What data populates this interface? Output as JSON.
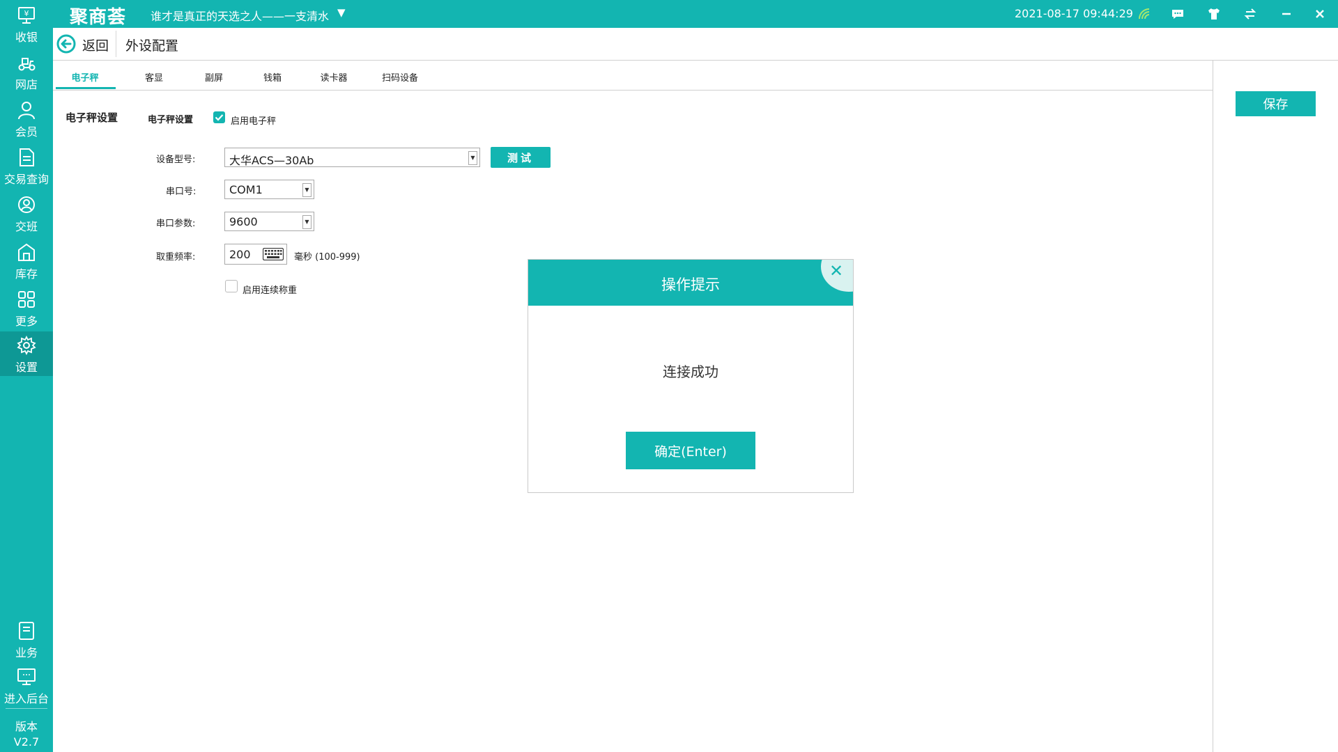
{
  "titlebar": {
    "logo": "聚商荟",
    "store_name": "谁才是真正的天选之人——一支清水",
    "datetime": "2021-08-17 09:44:29"
  },
  "sidebar": {
    "items": [
      {
        "label": "收银",
        "icon": "cashier-icon"
      },
      {
        "label": "网店",
        "icon": "scooter-icon"
      },
      {
        "label": "会员",
        "icon": "user-icon"
      },
      {
        "label": "交易查询",
        "icon": "document-icon"
      },
      {
        "label": "交班",
        "icon": "handover-icon"
      },
      {
        "label": "库存",
        "icon": "warehouse-icon"
      },
      {
        "label": "更多",
        "icon": "grid-icon"
      },
      {
        "label": "设置",
        "icon": "gear-icon"
      }
    ],
    "bottom_items": [
      {
        "label": "业务",
        "icon": "book-icon"
      },
      {
        "label": "进入后台",
        "icon": "monitor-icon"
      }
    ],
    "version_label": "版本",
    "version": "V2.7"
  },
  "header": {
    "back_label": "返回",
    "page_title": "外设配置"
  },
  "tabs": [
    {
      "label": "电子秤",
      "active": true
    },
    {
      "label": "客显",
      "active": false
    },
    {
      "label": "副屏",
      "active": false
    },
    {
      "label": "钱箱",
      "active": false
    },
    {
      "label": "读卡器",
      "active": false
    },
    {
      "label": "扫码设备",
      "active": false
    }
  ],
  "save_label": "保存",
  "form": {
    "section_title": "电子秤设置",
    "subsection_title": "电子秤设置",
    "enable_scale_label": "启用电子秤",
    "enable_scale_checked": true,
    "device_model_label": "设备型号:",
    "device_model_value": "大华ACS—30Ab",
    "test_label": "测试",
    "port_label": "串口号:",
    "port_value": "COM1",
    "params_label": "串口参数:",
    "params_value": "9600",
    "freq_label": "取重频率:",
    "freq_value": "200",
    "freq_unit": "毫秒 (100-999)",
    "continuous_label": "启用连续称重",
    "continuous_checked": false
  },
  "dialog": {
    "title": "操作提示",
    "message": "连接成功",
    "ok_label": "确定(Enter)"
  },
  "colors": {
    "accent": "#13b5b1",
    "accent_dark": "#0e9895"
  }
}
